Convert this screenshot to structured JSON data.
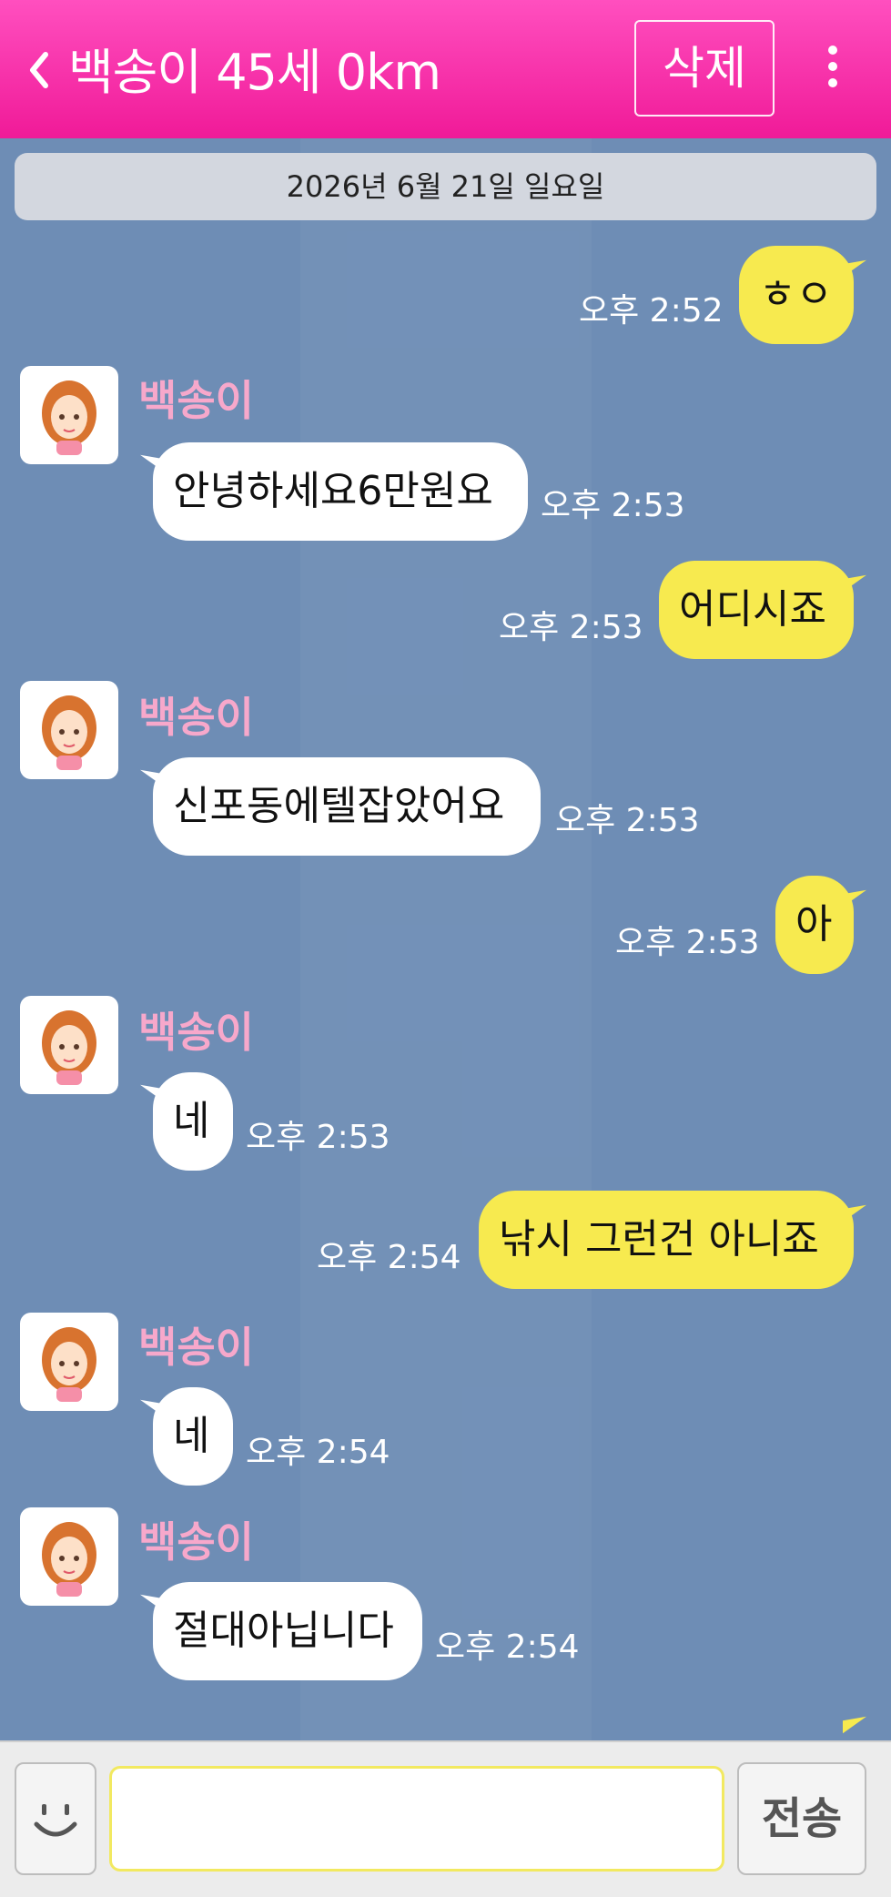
{
  "header": {
    "title": "백송이 45세 0km",
    "delete_label": "삭제",
    "back_icon": "chevron-left-icon",
    "more_icon": "more-vertical-icon",
    "colors": {
      "top": "#ff4fbf",
      "bottom": "#f01a98"
    }
  },
  "chat": {
    "date_label": "2026년 6월 21일 일요일",
    "background": "#6e8db5",
    "messages": [
      {
        "from": "me",
        "text": "ㅎㅇ",
        "time": "오후 2:52"
      },
      {
        "from": "them",
        "sender": "백송이",
        "text": "안녕하세요6만원요",
        "time": "오후 2:53"
      },
      {
        "from": "me",
        "text": "어디시죠",
        "time": "오후 2:53"
      },
      {
        "from": "them",
        "sender": "백송이",
        "text": "신포동에텔잡았어요",
        "time": "오후 2:53"
      },
      {
        "from": "me",
        "text": "아",
        "time": "오후 2:53"
      },
      {
        "from": "them",
        "sender": "백송이",
        "text": "네",
        "time": "오후 2:53"
      },
      {
        "from": "me",
        "text": "낚시 그런건 아니죠",
        "time": "오후 2:54"
      },
      {
        "from": "them",
        "sender": "백송이",
        "text": "네",
        "time": "오후 2:54"
      },
      {
        "from": "them",
        "sender": "백송이",
        "text": "절대아닙니다",
        "time": "오후 2:54"
      }
    ]
  },
  "input": {
    "emoji_icon": "smiley-icon",
    "send_label": "전송",
    "value": "",
    "placeholder": ""
  },
  "colors": {
    "my_bubble": "#f7ea4f",
    "their_bubble": "#ffffff",
    "sender_name": "#f7a8cb"
  }
}
